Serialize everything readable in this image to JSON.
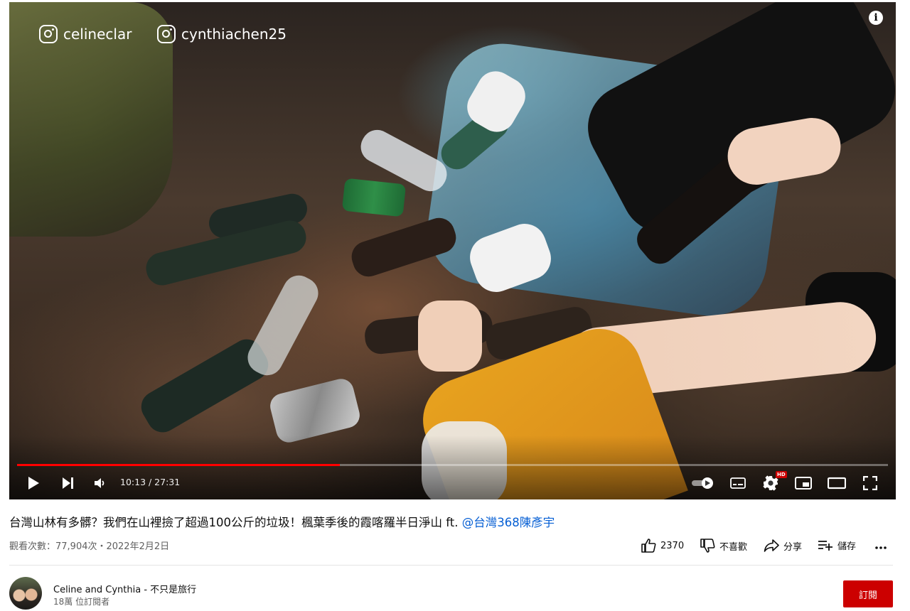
{
  "player": {
    "watermarks": [
      "celineclar",
      "cynthiachen25"
    ],
    "info_icon": "info-icon",
    "current_time": "10:13",
    "duration": "27:31",
    "time_display": "10:13 / 27:31",
    "progress_fraction": 0.371,
    "hd_badge": "HD",
    "icons": {
      "play": "play-icon",
      "next": "next-icon",
      "volume": "volume-icon",
      "autoplay": "autoplay-toggle-icon",
      "captions": "subtitles-icon",
      "settings": "gear-icon",
      "miniplayer": "miniplayer-icon",
      "theater": "theater-mode-icon",
      "fullscreen": "fullscreen-icon"
    }
  },
  "video": {
    "title_text": "台灣山林有多髒？我們在山裡撿了超過100公斤的垃圾！楓葉季後的霞喀羅半日淨山 ft. ",
    "title_mention": "@台灣368陳彥宇",
    "views_date": "觀看次數：77,904次・2022年2月2日"
  },
  "actions": {
    "like_count": "2370",
    "dislike_label": "不喜歡",
    "share_label": "分享",
    "save_label": "儲存",
    "more_label": "..."
  },
  "channel": {
    "name": "Celine and Cynthia - 不只是旅行",
    "subscribers": "18萬 位訂閱者",
    "subscribe_label": "訂閱"
  },
  "colors": {
    "accent_red": "#cc0000",
    "progress_red": "#ff0000",
    "link_blue": "#065fd4",
    "meta_gray": "#606060"
  }
}
